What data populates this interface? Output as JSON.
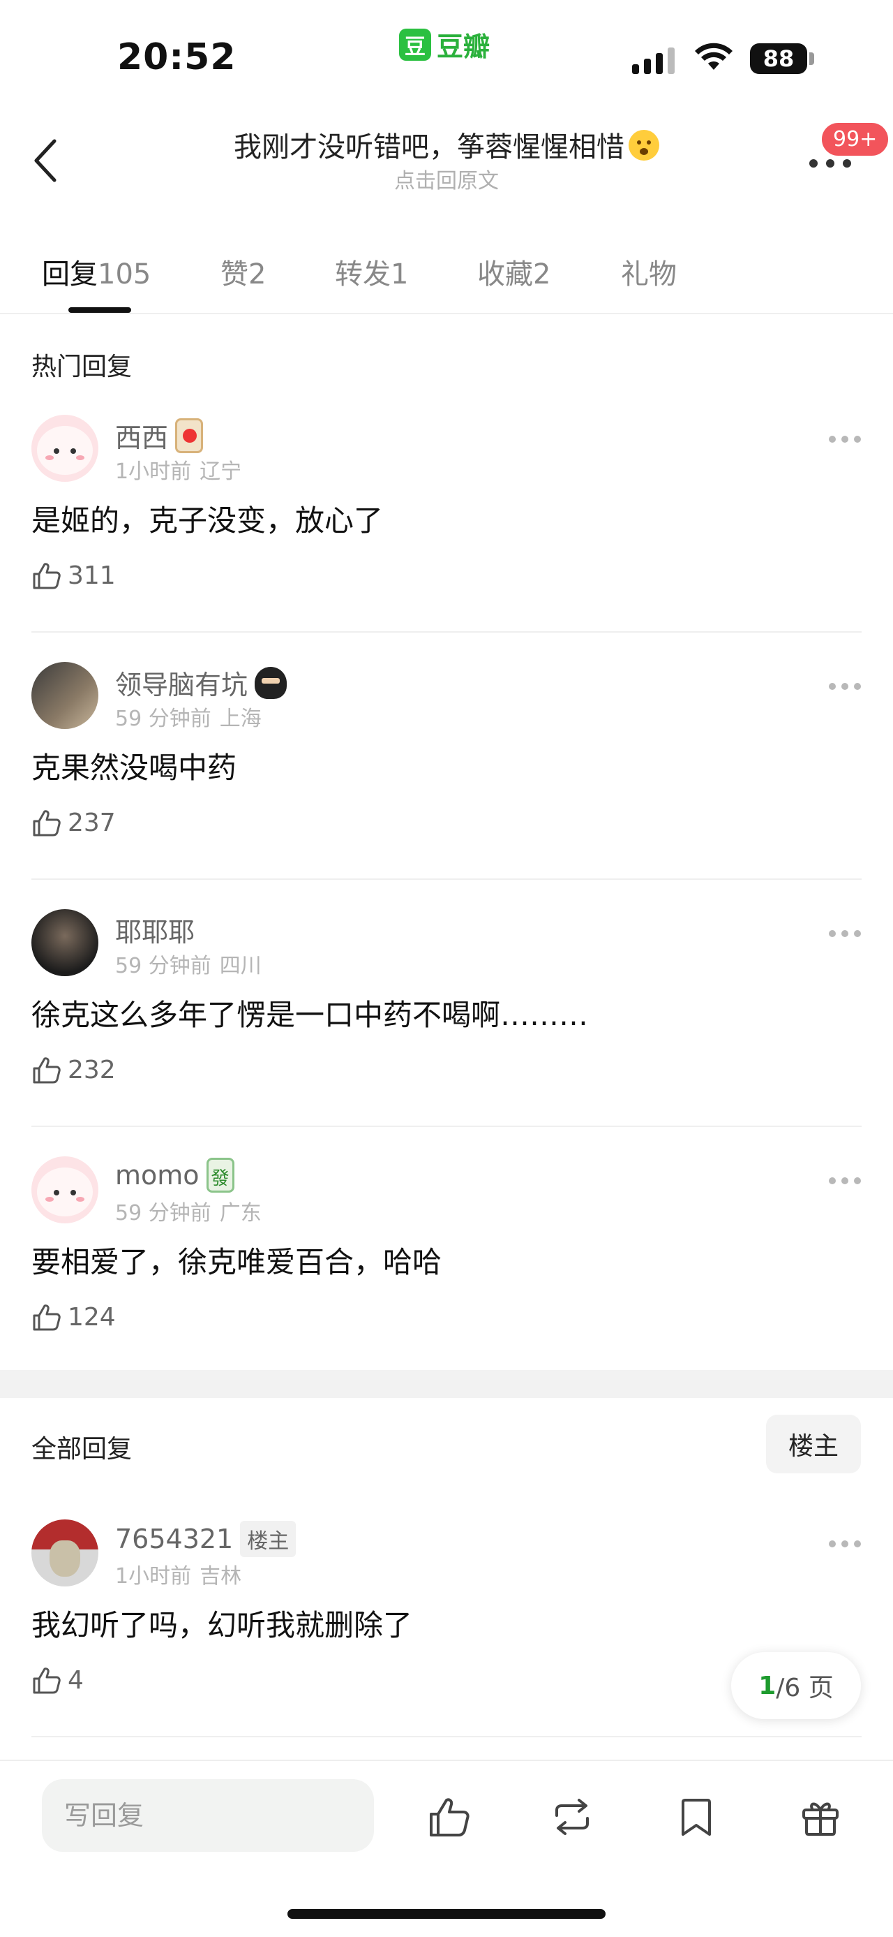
{
  "status_bar": {
    "time": "20:52",
    "app_name": "豆瓣",
    "app_logo_char": "豆",
    "battery": "88"
  },
  "nav": {
    "title": "我刚才没听错吧，筝蓉惺惺相惜",
    "subtitle": "点击回原文",
    "notification_badge": "99+"
  },
  "tabs": [
    {
      "label": "回复",
      "count": "105",
      "active": true
    },
    {
      "label": "赞",
      "count": "2"
    },
    {
      "label": "转发",
      "count": "1"
    },
    {
      "label": "收藏",
      "count": "2"
    },
    {
      "label": "礼物",
      "count": ""
    }
  ],
  "hot_section": {
    "title": "热门回复"
  },
  "hot_replies": [
    {
      "username": "西西",
      "time": "1小时前",
      "location": "辽宁",
      "content": "是姬的，克子没变，放心了",
      "likes": "311"
    },
    {
      "username": "领导脑有坑",
      "time": "59 分钟前",
      "location": "上海",
      "content": "克果然没喝中药",
      "likes": "237"
    },
    {
      "username": "耶耶耶",
      "time": "59 分钟前",
      "location": "四川",
      "content": "徐克这么多年了愣是一口中药不喝啊………",
      "likes": "232"
    },
    {
      "username": "momo",
      "time": "59 分钟前",
      "location": "广东",
      "content": "要相爱了，徐克唯爱百合，哈哈",
      "likes": "124"
    }
  ],
  "all_section": {
    "title": "全部回复",
    "filter_label": "楼主"
  },
  "all_replies": [
    {
      "username": "7654321",
      "tag": "楼主",
      "time": "1小时前",
      "location": "吉林",
      "content": "我幻听了吗，幻听我就删除了",
      "likes": "4"
    }
  ],
  "pager": {
    "current": "1",
    "total_text": "/6 页"
  },
  "bottom_bar": {
    "reply_placeholder": "写回复"
  }
}
